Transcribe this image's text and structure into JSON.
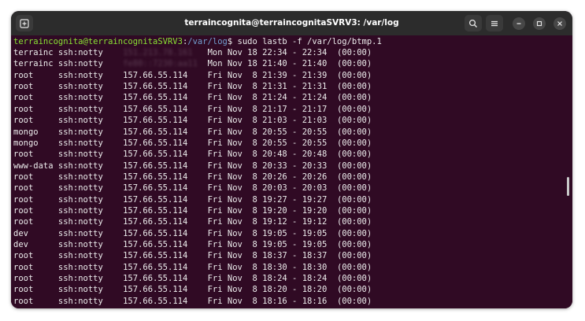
{
  "window": {
    "title": "terraincognita@terraincognitaSVRV3: /var/log"
  },
  "icons": {
    "new_tab": "new-tab-icon",
    "search": "search-icon",
    "menu": "hamburger-menu-icon",
    "minimize": "minimize-icon",
    "maximize": "maximize-icon",
    "close": "close-icon"
  },
  "prompt": {
    "user_host": "terraincognita@terraincognitaSVRV3",
    "sep": ":",
    "path": "/var/log",
    "dollar": "$",
    "command": " sudo lastb -f /var/log/btmp.1"
  },
  "rows": [
    {
      "user": "terrainc",
      "tty": "ssh:notty",
      "host": "151.213.78.161",
      "time": "Mon Nov 18 22:34 - 22:34  (00:00)",
      "redacted": true
    },
    {
      "user": "terrainc",
      "tty": "ssh:notty",
      "host": "fe80::7230:aa11",
      "time": "Mon Nov 18 21:40 - 21:40  (00:00)",
      "redacted": true
    },
    {
      "user": "root",
      "tty": "ssh:notty",
      "host": "157.66.55.114",
      "time": "Fri Nov  8 21:39 - 21:39  (00:00)"
    },
    {
      "user": "root",
      "tty": "ssh:notty",
      "host": "157.66.55.114",
      "time": "Fri Nov  8 21:31 - 21:31  (00:00)"
    },
    {
      "user": "root",
      "tty": "ssh:notty",
      "host": "157.66.55.114",
      "time": "Fri Nov  8 21:24 - 21:24  (00:00)"
    },
    {
      "user": "root",
      "tty": "ssh:notty",
      "host": "157.66.55.114",
      "time": "Fri Nov  8 21:17 - 21:17  (00:00)"
    },
    {
      "user": "root",
      "tty": "ssh:notty",
      "host": "157.66.55.114",
      "time": "Fri Nov  8 21:03 - 21:03  (00:00)"
    },
    {
      "user": "mongo",
      "tty": "ssh:notty",
      "host": "157.66.55.114",
      "time": "Fri Nov  8 20:55 - 20:55  (00:00)"
    },
    {
      "user": "mongo",
      "tty": "ssh:notty",
      "host": "157.66.55.114",
      "time": "Fri Nov  8 20:55 - 20:55  (00:00)"
    },
    {
      "user": "root",
      "tty": "ssh:notty",
      "host": "157.66.55.114",
      "time": "Fri Nov  8 20:48 - 20:48  (00:00)"
    },
    {
      "user": "www-data",
      "tty": "ssh:notty",
      "host": "157.66.55.114",
      "time": "Fri Nov  8 20:33 - 20:33  (00:00)"
    },
    {
      "user": "root",
      "tty": "ssh:notty",
      "host": "157.66.55.114",
      "time": "Fri Nov  8 20:26 - 20:26  (00:00)"
    },
    {
      "user": "root",
      "tty": "ssh:notty",
      "host": "157.66.55.114",
      "time": "Fri Nov  8 20:03 - 20:03  (00:00)"
    },
    {
      "user": "root",
      "tty": "ssh:notty",
      "host": "157.66.55.114",
      "time": "Fri Nov  8 19:27 - 19:27  (00:00)"
    },
    {
      "user": "root",
      "tty": "ssh:notty",
      "host": "157.66.55.114",
      "time": "Fri Nov  8 19:20 - 19:20  (00:00)"
    },
    {
      "user": "root",
      "tty": "ssh:notty",
      "host": "157.66.55.114",
      "time": "Fri Nov  8 19:12 - 19:12  (00:00)"
    },
    {
      "user": "dev",
      "tty": "ssh:notty",
      "host": "157.66.55.114",
      "time": "Fri Nov  8 19:05 - 19:05  (00:00)"
    },
    {
      "user": "dev",
      "tty": "ssh:notty",
      "host": "157.66.55.114",
      "time": "Fri Nov  8 19:05 - 19:05  (00:00)"
    },
    {
      "user": "root",
      "tty": "ssh:notty",
      "host": "157.66.55.114",
      "time": "Fri Nov  8 18:37 - 18:37  (00:00)"
    },
    {
      "user": "root",
      "tty": "ssh:notty",
      "host": "157.66.55.114",
      "time": "Fri Nov  8 18:30 - 18:30  (00:00)"
    },
    {
      "user": "root",
      "tty": "ssh:notty",
      "host": "157.66.55.114",
      "time": "Fri Nov  8 18:24 - 18:24  (00:00)"
    },
    {
      "user": "root",
      "tty": "ssh:notty",
      "host": "157.66.55.114",
      "time": "Fri Nov  8 18:20 - 18:20  (00:00)"
    },
    {
      "user": "root",
      "tty": "ssh:notty",
      "host": "157.66.55.114",
      "time": "Fri Nov  8 18:16 - 18:16  (00:00)"
    }
  ],
  "colors": {
    "terminal_bg": "#300a24",
    "titlebar_bg": "#2c2c2c",
    "prompt_user": "#8ae234",
    "prompt_path": "#729fcf",
    "text": "#ececec"
  }
}
